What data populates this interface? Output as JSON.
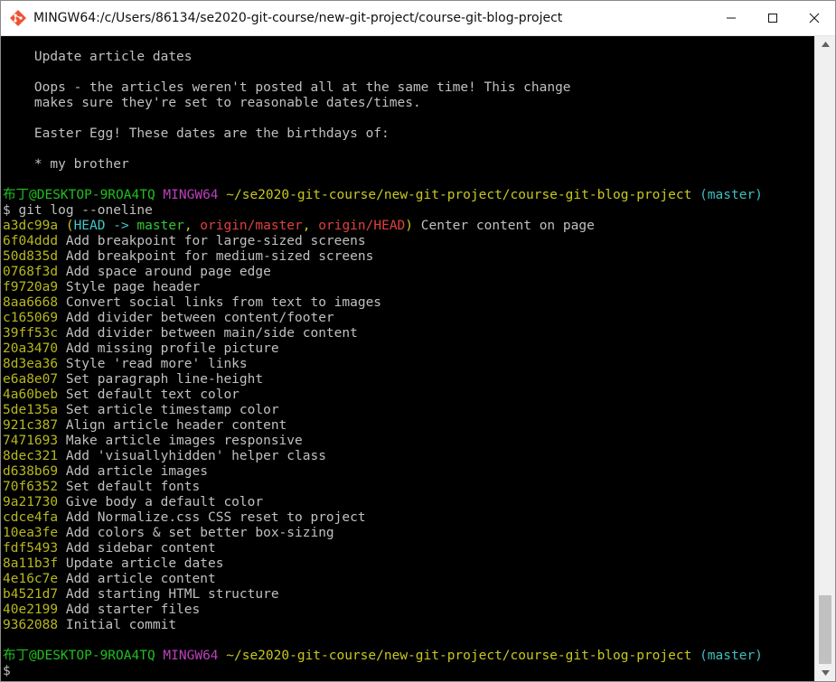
{
  "window": {
    "title": "MINGW64:/c/Users/86134/se2020-git-course/new-git-project/course-git-blog-project"
  },
  "colors": {
    "terminal_bg": "#000000",
    "text": "#c0c0c0",
    "prompt_user": "#1fbf1f",
    "prompt_env": "#bf3fbf",
    "prompt_path": "#c8c81f",
    "prompt_branch": "#3fbfbf",
    "hash": "#b7b720",
    "ref_red": "#e04040"
  },
  "terminal": {
    "message_lines": [
      "    Update article dates",
      "",
      "    Oops - the articles weren't posted all at the same time! This change",
      "    makes sure they're set to reasonable dates/times.",
      "",
      "    Easter Egg! These dates are the birthdays of:",
      "",
      "    * my brother",
      ""
    ],
    "prompt1": {
      "user": "布丁@DESKTOP-9ROA4TQ",
      "env": "MINGW64",
      "path": "~/se2020-git-course/new-git-project/course-git-blog-project",
      "branch": "(master)"
    },
    "command": "$ git log --oneline",
    "head_commit": {
      "hash": "a3dc99a",
      "paren_open": "(",
      "head_label": "HEAD -> ",
      "local_branch": "master",
      "sep1": ", ",
      "remote1": "origin/master",
      "sep2": ", ",
      "remote2": "origin/HEAD",
      "paren_close": ")",
      "message": "Center content on page"
    },
    "commits": [
      {
        "hash": "6f04ddd",
        "message": "Add breakpoint for large-sized screens"
      },
      {
        "hash": "50d835d",
        "message": "Add breakpoint for medium-sized screens"
      },
      {
        "hash": "0768f3d",
        "message": "Add space around page edge"
      },
      {
        "hash": "f9720a9",
        "message": "Style page header"
      },
      {
        "hash": "8aa6668",
        "message": "Convert social links from text to images"
      },
      {
        "hash": "c165069",
        "message": "Add divider between content/footer"
      },
      {
        "hash": "39ff53c",
        "message": "Add divider between main/side content"
      },
      {
        "hash": "20a3470",
        "message": "Add missing profile picture"
      },
      {
        "hash": "8d3ea36",
        "message": "Style 'read more' links"
      },
      {
        "hash": "e6a8e07",
        "message": "Set paragraph line-height"
      },
      {
        "hash": "4a60beb",
        "message": "Set default text color"
      },
      {
        "hash": "5de135a",
        "message": "Set article timestamp color"
      },
      {
        "hash": "921c387",
        "message": "Align article header content"
      },
      {
        "hash": "7471693",
        "message": "Make article images responsive"
      },
      {
        "hash": "8dec321",
        "message": "Add 'visuallyhidden' helper class"
      },
      {
        "hash": "d638b69",
        "message": "Add article images"
      },
      {
        "hash": "70f6352",
        "message": "Set default fonts"
      },
      {
        "hash": "9a21730",
        "message": "Give body a default color"
      },
      {
        "hash": "cdce4fa",
        "message": "Add Normalize.css CSS reset to project"
      },
      {
        "hash": "10ea3fe",
        "message": "Add colors & set better box-sizing"
      },
      {
        "hash": "fdf5493",
        "message": "Add sidebar content"
      },
      {
        "hash": "8a11b3f",
        "message": "Update article dates"
      },
      {
        "hash": "4e16c7e",
        "message": "Add article content"
      },
      {
        "hash": "b4521d7",
        "message": "Add starting HTML structure"
      },
      {
        "hash": "40e2199",
        "message": "Add starter files"
      },
      {
        "hash": "9362088",
        "message": "Initial commit"
      }
    ],
    "prompt2": {
      "user": "布丁@DESKTOP-9ROA4TQ",
      "env": "MINGW64",
      "path": "~/se2020-git-course/new-git-project/course-git-blog-project",
      "branch": "(master)"
    },
    "final_prompt": "$"
  },
  "icons": {
    "app": "git-bash-icon",
    "minimize": "minimize-icon",
    "maximize": "maximize-icon",
    "close": "close-icon",
    "scroll_up": "scroll-up-arrow-icon",
    "scroll_down": "scroll-down-arrow-icon"
  }
}
